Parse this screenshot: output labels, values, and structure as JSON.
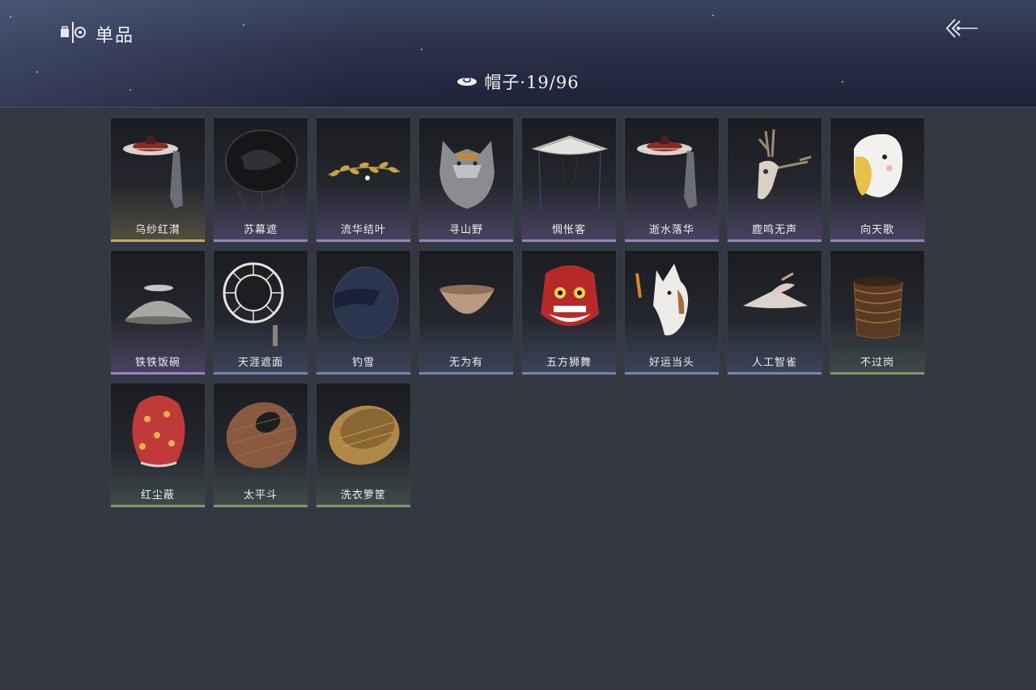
{
  "header": {
    "title": "单品",
    "title_icon": "wardrobe-icon",
    "back_icon": "back-arrow-icon"
  },
  "category": {
    "icon": "hat-icon",
    "label": "帽子·19/96"
  },
  "colors": {
    "gold": "#c2a95a",
    "purple": "#9b7fc0",
    "blue": "#7187b0",
    "green": "#7f9a6e"
  },
  "items": [
    {
      "name": "乌纱红潸",
      "rarity": "gold",
      "art": "veiled-hat"
    },
    {
      "name": "苏幕遮",
      "rarity": "purple",
      "art": "black-hat"
    },
    {
      "name": "流华结叶",
      "rarity": "purple",
      "art": "laurel"
    },
    {
      "name": "寻山野",
      "rarity": "purple",
      "art": "wolf"
    },
    {
      "name": "惆怅客",
      "rarity": "purple",
      "art": "conical"
    },
    {
      "name": "逝水落华",
      "rarity": "purple",
      "art": "veiled-hat"
    },
    {
      "name": "鹿鸣无声",
      "rarity": "purple",
      "art": "deer-skull"
    },
    {
      "name": "向天歌",
      "rarity": "purple",
      "art": "goose"
    },
    {
      "name": "铁铁饭碗",
      "rarity": "purple",
      "art": "bowl-metal"
    },
    {
      "name": "天涯遮面",
      "rarity": "blue",
      "art": "frame-hat"
    },
    {
      "name": "钓雪",
      "rarity": "blue",
      "art": "dark-hood"
    },
    {
      "name": "无为有",
      "rarity": "blue",
      "art": "bowl-clay"
    },
    {
      "name": "五方狮舞",
      "rarity": "blue",
      "art": "lion"
    },
    {
      "name": "好运当头",
      "rarity": "blue",
      "art": "horse"
    },
    {
      "name": "人工智雀",
      "rarity": "blue",
      "art": "bird-plate"
    },
    {
      "name": "不过岗",
      "rarity": "green",
      "art": "bowl-stack"
    },
    {
      "name": "红尘蔽",
      "rarity": "green",
      "art": "red-lantern"
    },
    {
      "name": "太平斗",
      "rarity": "green",
      "art": "basket-ring"
    },
    {
      "name": "洗衣箩筐",
      "rarity": "green",
      "art": "basket"
    }
  ]
}
